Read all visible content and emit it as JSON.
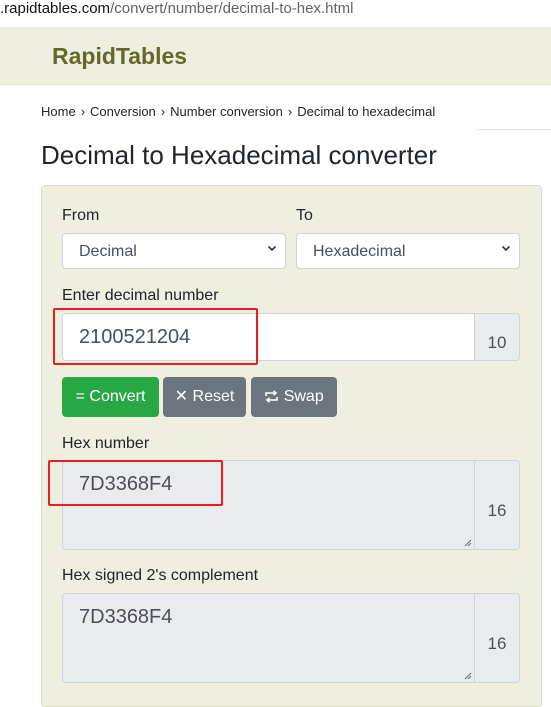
{
  "url": {
    "domain": ".rapidtables.com",
    "path": "/convert/number/decimal-to-hex.html"
  },
  "site": {
    "logo": "RapidTables"
  },
  "breadcrumb": {
    "items": [
      "Home",
      "Conversion",
      "Number conversion",
      "Decimal to hexadecimal"
    ],
    "separator": "›"
  },
  "page": {
    "title": "Decimal to Hexadecimal converter"
  },
  "form": {
    "from_label": "From",
    "from_value": "Decimal",
    "to_label": "To",
    "to_value": "Hexadecimal",
    "input_label": "Enter decimal number",
    "input_value": "2100521204",
    "input_base": "10",
    "convert_label": "= Convert",
    "reset_label": "Reset",
    "reset_icon_glyph": "✕",
    "swap_label": "Swap",
    "hex_label": "Hex number",
    "hex_value": "7D3368F4",
    "hex_base": "16",
    "twos_label": "Hex signed 2's complement",
    "twos_value": "7D3368F4",
    "twos_base": "16"
  },
  "colors": {
    "accent_green": "#28a745",
    "button_gray": "#6c757d",
    "panel_bg": "#efefdf",
    "highlight_red": "#ee1c1c",
    "logo": "#66662d"
  }
}
